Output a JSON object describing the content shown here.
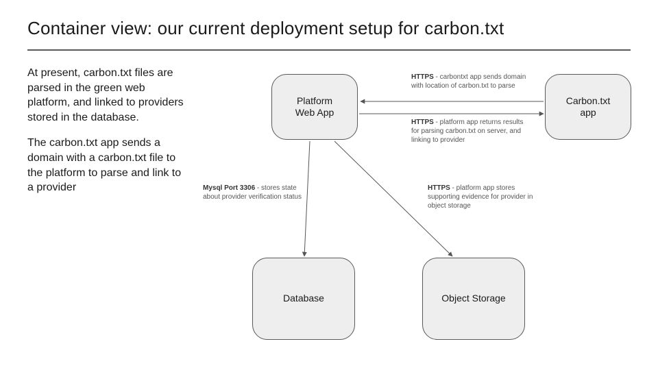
{
  "title": "Container view: our current deployment setup for carbon.txt",
  "paragraphs": {
    "p1": "At present, carbon.txt files are parsed in the green web platform, and linked to providers stored in the database.",
    "p2": "The carbon.txt app sends a domain with a carbon.txt file to the platform to parse and link to a provider"
  },
  "nodes": {
    "platform": "Platform\nWeb App",
    "carbonapp": "Carbon.txt\napp",
    "database": "Database",
    "objstore": "Object Storage"
  },
  "edges": {
    "toPlatform": {
      "bold": "HTTPS",
      "rest": " - carbontxt app sends domain with location of carbon.txt to parse"
    },
    "toCarbon": {
      "bold": "HTTPS",
      "rest": " - platform app returns results for parsing carbon.txt on server, and linking to provider"
    },
    "toDb": {
      "bold": "Mysql Port 3306",
      "rest": " - stores state about provider verification status"
    },
    "toObj": {
      "bold": "HTTPS",
      "rest": " - platform app stores supporting evidence for provider in object storage"
    }
  }
}
